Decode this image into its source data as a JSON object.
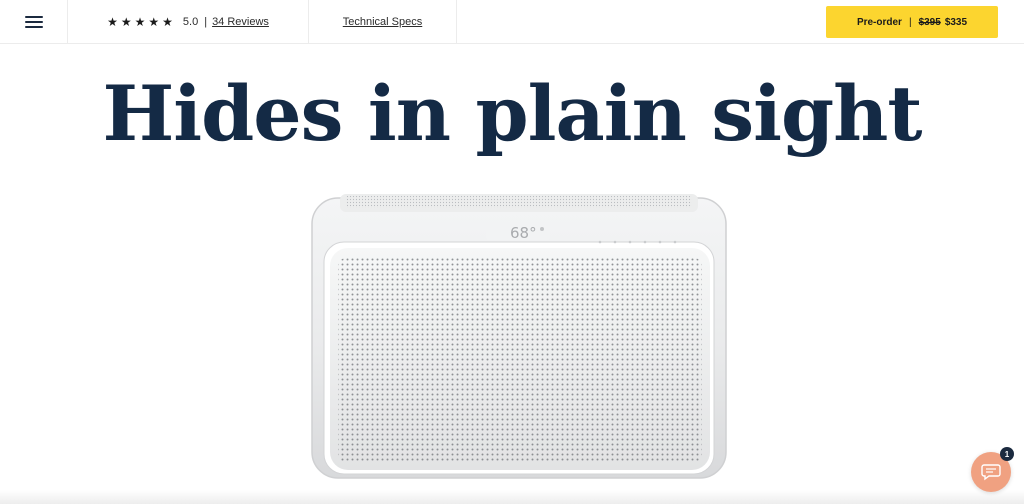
{
  "nav": {
    "menu_icon": "hamburger-menu-icon",
    "stars": [
      "★",
      "★",
      "★",
      "★",
      "★"
    ],
    "rating": "5.0",
    "divider": "|",
    "reviews_link": "34 Reviews",
    "specs_link": "Technical Specs",
    "preorder": {
      "label": "Pre-order",
      "divider": "|",
      "old_price": "$395",
      "new_price": "$335"
    }
  },
  "hero": {
    "headline": "Hides in plain sight",
    "display_temperature": "68°"
  },
  "chat": {
    "icon": "chat-bubble-icon",
    "badge_count": "1"
  },
  "colors": {
    "accent_yellow": "#fcd52f",
    "navy": "#142a45",
    "chat_orange": "#f0a181"
  }
}
